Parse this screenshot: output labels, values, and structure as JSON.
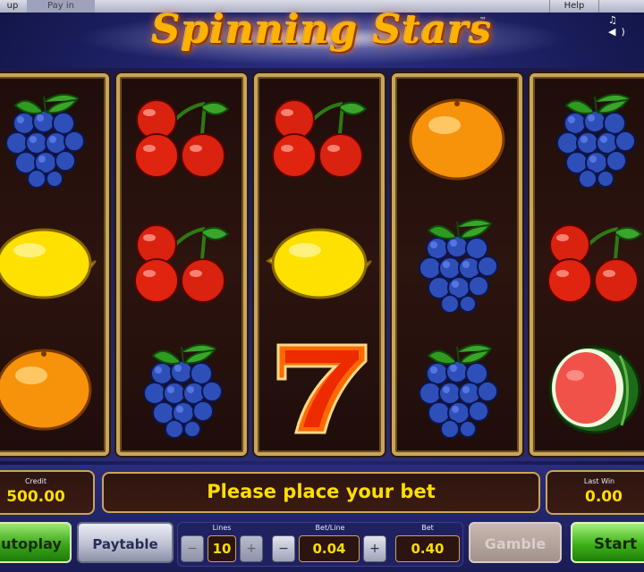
{
  "topbar": {
    "setup_tab": "up",
    "payin_tab": "Pay in",
    "help_tab": "Help",
    "sound_icons": "♫ ◀)"
  },
  "title": "Spinning Stars",
  "trademark": "™",
  "reels": [
    {
      "symbols": [
        "grapes",
        "lemon",
        "orange"
      ]
    },
    {
      "symbols": [
        "cherries",
        "cherries",
        "grapes"
      ]
    },
    {
      "symbols": [
        "cherries",
        "lemon",
        "seven"
      ]
    },
    {
      "symbols": [
        "orange",
        "grapes",
        "grapes"
      ]
    },
    {
      "symbols": [
        "grapes",
        "cherries",
        "watermelon"
      ]
    }
  ],
  "credit": {
    "label": "Credit",
    "value": "500.00"
  },
  "message": "Please place your bet",
  "last_win": {
    "label": "Last Win",
    "value": "0.00"
  },
  "buttons": {
    "autoplay": "utoplay",
    "paytable": "Paytable",
    "gamble": "Gamble",
    "start": "Start"
  },
  "lines": {
    "label": "Lines",
    "value": "10",
    "minus": "−",
    "plus": "+"
  },
  "bet_line": {
    "label": "Bet/Line",
    "value": "0.04",
    "minus": "−",
    "plus": "+"
  },
  "bet": {
    "label": "Bet",
    "value": "0.40"
  },
  "colors": {
    "gold_text": "#ffde00",
    "frame_gold": "#c9a55a",
    "start_green": "#3fb21a"
  }
}
